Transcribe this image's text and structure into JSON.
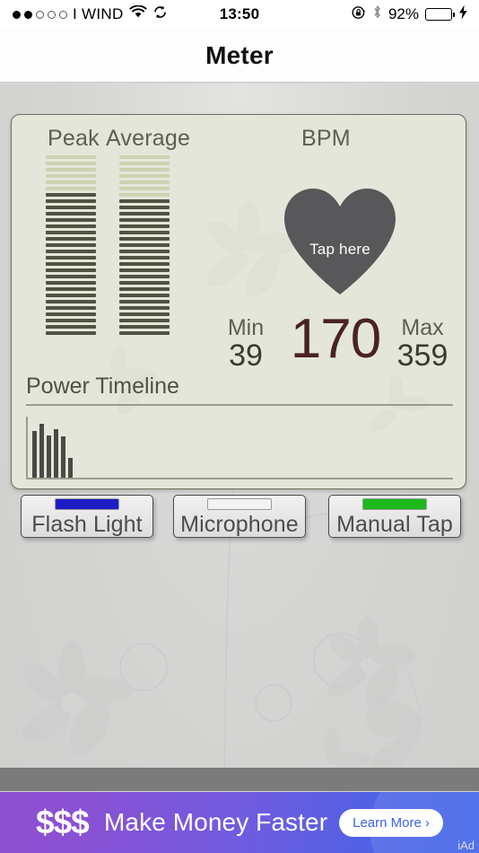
{
  "statusbar": {
    "signal_dots_filled": 2,
    "signal_dots_total": 5,
    "carrier": "I WIND",
    "wifi_icon": "wifi-icon",
    "sync_icon": "sync-icon",
    "time": "13:50",
    "rotation_lock_icon": "rotation-lock-icon",
    "bluetooth_icon": "bluetooth-icon",
    "battery_percent": "92%",
    "battery_level": 92,
    "battery_color": "#44d15c",
    "charging_icon": "charging-bolt-icon"
  },
  "navbar": {
    "title": "Meter"
  },
  "meter_card": {
    "peak_label": "Peak",
    "average_label": "Average",
    "bpm_label": "BPM",
    "heart": {
      "name": "heart-shape",
      "tap_label": "Tap here",
      "color": "#58585a"
    },
    "peak_meter": {
      "total_segments": 29,
      "lit_segments": 23,
      "off_color": "#cfd2b0",
      "on_color": "#4f5342"
    },
    "average_meter": {
      "total_segments": 29,
      "lit_segments": 22,
      "off_color": "#cfd2b0",
      "on_color": "#4f5342"
    },
    "min_caption": "Min",
    "min_value": "39",
    "bpm_value": "170",
    "bpm_color": "#4b2222",
    "max_caption": "Max",
    "max_value": "359",
    "power_timeline_title": "Power Timeline",
    "power_timeline_bars": [
      52,
      60,
      47,
      54,
      46,
      22
    ]
  },
  "buttons": [
    {
      "label": "Flash Light",
      "led_name": "flash-light-led",
      "led_color": "#1d1dc6",
      "active": true
    },
    {
      "label": "Microphone",
      "led_name": "microphone-led",
      "led_color": "#f3f3f3",
      "active": false
    },
    {
      "label": "Manual Tap",
      "led_name": "manual-tap-led",
      "led_color": "#1cb81c",
      "active": true
    }
  ],
  "ad": {
    "dollars": "$$$",
    "headline": "Make Money Faster",
    "cta": "Learn More ›",
    "provider": "iAd"
  }
}
